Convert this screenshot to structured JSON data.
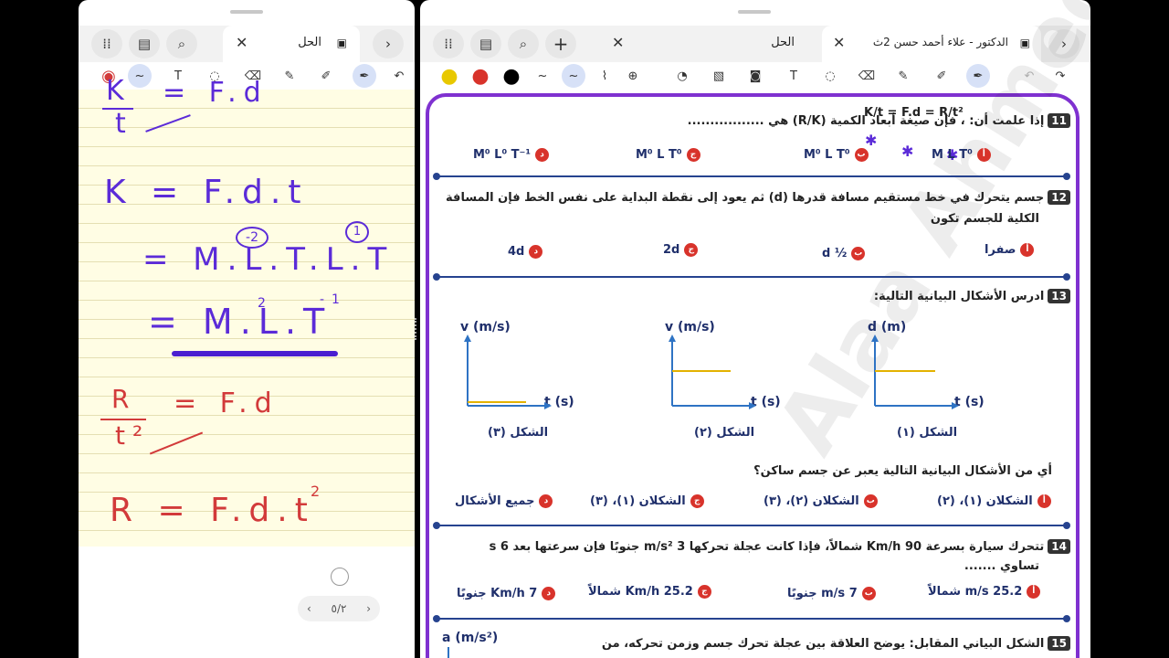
{
  "left": {
    "tab_title": "الحل",
    "handwriting": {
      "l1_num": "K",
      "l1_den": "t",
      "l1_rhs": "= F.d",
      "l2": "K = F.d.t",
      "l3": "= M.L.T.L.T",
      "l3_exp1": "-2",
      "l3_exp2": "1",
      "l4": "= M.L.T",
      "l4_exp1": "2",
      "l4_exp2": "-1",
      "l5_num": "R",
      "l5_den": "t²",
      "l5_rhs": "= F.d",
      "l6": "R = F.d.t",
      "l6_exp": "2"
    },
    "pager": "٥/٢"
  },
  "right": {
    "tab_solution": "الحل",
    "tab_active": "الدكتور - علاء أحمد حسن 2ث",
    "colors": {
      "frame": "#7f31d0",
      "accent": "#d8332b",
      "navy": "#26438f"
    },
    "q11": {
      "num": "11",
      "text": "إذا علمت أن: ، فإن صيغة أبعاد الكمية (R/K) هي .................",
      "formula": "K/t = F.d = R/t²",
      "options": [
        {
          "letter": "أ",
          "text": "M L T⁰"
        },
        {
          "letter": "ب",
          "text": "M⁰ L T⁰"
        },
        {
          "letter": "ج",
          "text": "M⁰ L T⁰"
        },
        {
          "letter": "د",
          "text": "M⁰ L⁰ T⁻¹"
        }
      ]
    },
    "q12": {
      "num": "12",
      "line1": "جسم يتحرك في خط مستقيم مسافة قدرها (d) ثم يعود إلى نقطة البداية على نفس الخط فإن المسافة",
      "line2": "الكلية للجسم تكون",
      "options": [
        {
          "letter": "أ",
          "text": "صفرا"
        },
        {
          "letter": "ب",
          "text": "½ d"
        },
        {
          "letter": "ج",
          "text": "2d"
        },
        {
          "letter": "د",
          "text": "4d"
        }
      ]
    },
    "q13": {
      "num": "13",
      "text": "ادرس الأشكال البيانية التالية:",
      "graphs": [
        {
          "ylabel": "d (m)",
          "xlabel": "t (s)",
          "caption": "الشكل (١)"
        },
        {
          "ylabel": "v (m/s)",
          "xlabel": "t (s)",
          "caption": "الشكل (٢)"
        },
        {
          "ylabel": "v (m/s)",
          "xlabel": "t (s)",
          "caption": "الشكل (٣)"
        }
      ],
      "question": "أي من الأشكال البيانية التالية يعبر عن جسم ساكن؟",
      "options": [
        {
          "letter": "أ",
          "text": "الشكلان (١)، (٢)"
        },
        {
          "letter": "ب",
          "text": "الشكلان (٢)، (٣)"
        },
        {
          "letter": "ج",
          "text": "الشكلان (١)، (٣)"
        },
        {
          "letter": "د",
          "text": "جميع الأشكال"
        }
      ]
    },
    "q14": {
      "num": "14",
      "line1": "تتحرك سيارة بسرعة 90 Km/h شمالاً، فإذا كانت عجلة تحركها 3 m/s² جنوبًا فإن سرعتها بعد 6 s",
      "line2": "تساوي .......",
      "options": [
        {
          "letter": "أ",
          "text": "25.2 m/s شمالاً"
        },
        {
          "letter": "ب",
          "text": "7 m/s جنوبًا"
        },
        {
          "letter": "ج",
          "text": "25.2 Km/h شمالاً"
        },
        {
          "letter": "د",
          "text": "7 Km/h جنوبًا"
        }
      ]
    },
    "q15": {
      "num": "15",
      "text": "الشكل البياني المقابل: يوضح العلاقة بين عجلة تحرك جسم وزمن تحركه، من",
      "ylabel": "a (m/s²)"
    },
    "watermark": "Alaa Ahmed"
  }
}
